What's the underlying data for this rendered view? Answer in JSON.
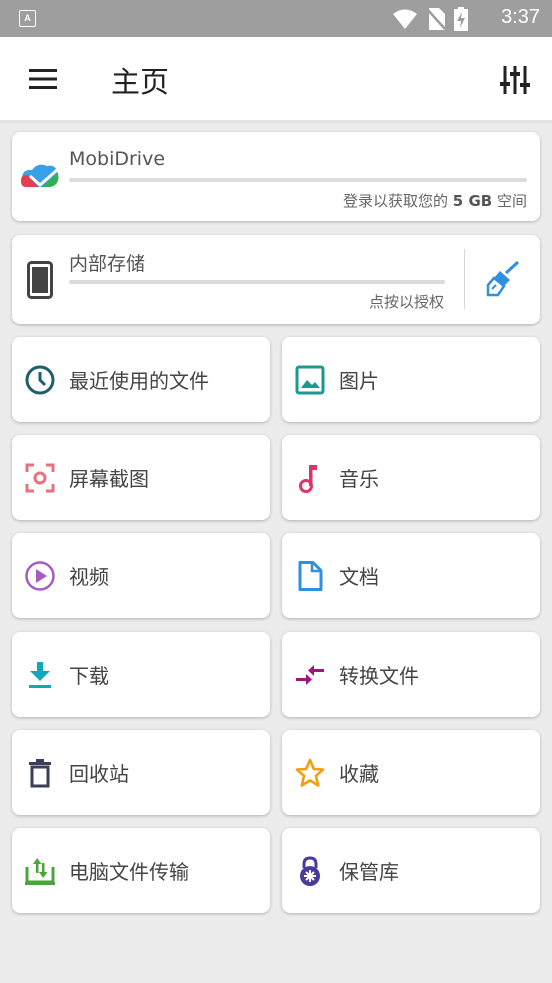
{
  "status_bar": {
    "notification_glyph": "A",
    "time": "3:37"
  },
  "app_bar": {
    "title": "主页"
  },
  "mobidrive": {
    "name": "MobiDrive",
    "hint_prefix": "登录以获取您的",
    "hint_bold": "5 GB",
    "hint_suffix": "空间"
  },
  "internal": {
    "name": "内部存储",
    "hint": "点按以授权"
  },
  "tiles": [
    {
      "label": "最近使用的文件",
      "icon": "clock-icon",
      "color": "#1f5f6b"
    },
    {
      "label": "图片",
      "icon": "image-icon",
      "color": "#1a9a8a"
    },
    {
      "label": "屏幕截图",
      "icon": "screenshot-icon",
      "color": "#e5727c"
    },
    {
      "label": "音乐",
      "icon": "music-note-icon",
      "color": "#d9366a"
    },
    {
      "label": "视频",
      "icon": "play-icon",
      "color": "#a35ec4"
    },
    {
      "label": "文档",
      "icon": "document-icon",
      "color": "#2f8fe0"
    },
    {
      "label": "下载",
      "icon": "download-icon",
      "color": "#14a6bd"
    },
    {
      "label": "转换文件",
      "icon": "convert-icon",
      "color": "#a0177c"
    },
    {
      "label": "回收站",
      "icon": "trash-icon",
      "color": "#3a3f5a"
    },
    {
      "label": "收藏",
      "icon": "star-icon",
      "color": "#f29f0f"
    },
    {
      "label": "电脑文件传输",
      "icon": "pc-transfer-icon",
      "color": "#4aa63a"
    },
    {
      "label": "保管库",
      "icon": "lock-icon",
      "color": "#4a3a9c"
    }
  ],
  "colors": {
    "broom": "#2f8fe0",
    "phone": "#444444"
  }
}
